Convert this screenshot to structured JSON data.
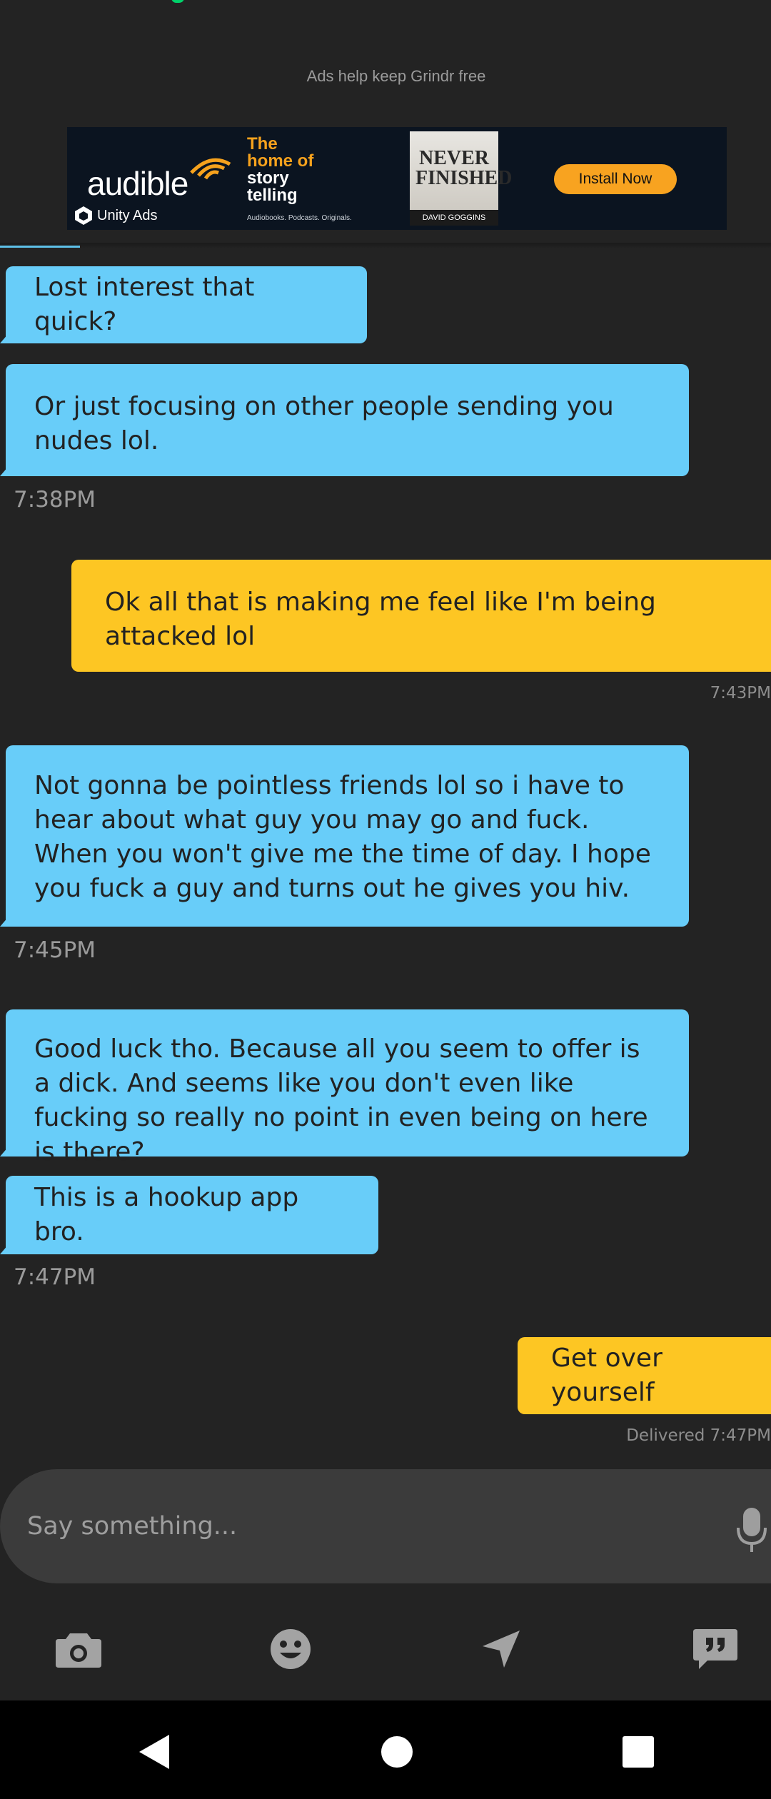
{
  "ad": {
    "note": "Ads help keep Grindr free",
    "brand": "audible",
    "tagline": [
      "The",
      "home of",
      "story",
      "telling"
    ],
    "subline": "Audiobooks. Podcasts. Originals.",
    "network": "Unity Ads",
    "book_title": "NEVER FINISHED",
    "book_author": "DAVID GOGGINS",
    "cta": "Install Now"
  },
  "messages": [
    {
      "dir": "in",
      "text": "Lost interest that quick?"
    },
    {
      "dir": "in",
      "text": "Or just focusing on other people sending you nudes lol."
    },
    {
      "dir": "time",
      "text": "7:38PM"
    },
    {
      "dir": "out",
      "text": "Ok all that is making me feel like I'm being attacked lol"
    },
    {
      "dir": "time",
      "text": "7:43PM"
    },
    {
      "dir": "in",
      "text": "Not gonna be pointless friends lol so i have to hear about what guy you may go and fuck. When you won't give me the time of day. I hope you fuck a guy and turns out he gives you hiv."
    },
    {
      "dir": "time",
      "text": "7:45PM"
    },
    {
      "dir": "in",
      "text": "Good luck tho. Because all you seem to offer is a dick. And seems like you don't even like fucking so really no point in even being on here is there?"
    },
    {
      "dir": "in",
      "text": "This is a hookup app bro."
    },
    {
      "dir": "time",
      "text": "7:47PM"
    },
    {
      "dir": "out",
      "text": "Get over yourself"
    },
    {
      "dir": "status",
      "text": "Delivered   7:47PM"
    }
  ],
  "composer": {
    "placeholder": "Say something..."
  },
  "toolbar_icons": [
    "camera-icon",
    "emoji-icon",
    "location-icon",
    "saved-phrases-icon"
  ],
  "colors": {
    "background": "#232323",
    "incoming": "#68cdf9",
    "outgoing": "#fdc623",
    "accent": "#f8a320"
  }
}
